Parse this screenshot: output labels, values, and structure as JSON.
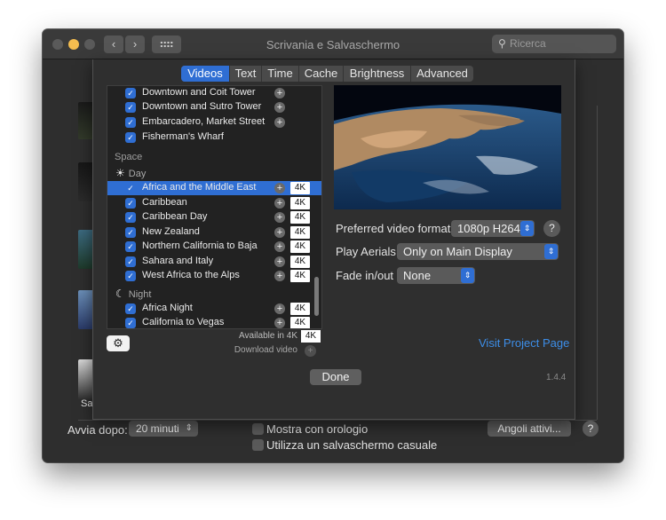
{
  "window": {
    "title": "Scrivania e Salvaschermo",
    "search_placeholder": "Ricerca",
    "nav_back": "‹",
    "nav_forward": "›"
  },
  "tabs": [
    "Videos",
    "Text",
    "Time",
    "Cache",
    "Brightness",
    "Advanced"
  ],
  "active_tab": "Videos",
  "video_list": {
    "city_items": [
      {
        "name": "Downtown and Coit Tower",
        "checked": true
      },
      {
        "name": "Downtown and Sutro Tower",
        "checked": true
      },
      {
        "name": "Embarcadero, Market Street",
        "checked": true
      },
      {
        "name": "Fisherman's Wharf",
        "checked": true
      }
    ],
    "section": "Space",
    "day_label": "Day",
    "day_items": [
      {
        "name": "Africa and the Middle East",
        "badge": "4K",
        "selected": true
      },
      {
        "name": "Caribbean",
        "badge": "4K"
      },
      {
        "name": "Caribbean Day",
        "badge": "4K"
      },
      {
        "name": "New Zealand",
        "badge": "4K"
      },
      {
        "name": "Northern California to Baja",
        "badge": "4K"
      },
      {
        "name": "Sahara and Italy",
        "badge": "4K"
      },
      {
        "name": "West Africa to the Alps",
        "badge": "4K"
      }
    ],
    "night_label": "Night",
    "night_items": [
      {
        "name": "Africa Night",
        "badge": "4K"
      },
      {
        "name": "California to Vegas",
        "badge": "4K"
      }
    ]
  },
  "legend": {
    "available_label": "Available in 4K",
    "available_badge": "4K",
    "download_label": "Download video"
  },
  "settings": {
    "preferred_format_label": "Preferred video format",
    "preferred_format_value": "1080p H264",
    "play_aerials_label": "Play Aerials",
    "play_aerials_value": "Only on Main Display",
    "fade_label": "Fade in/out",
    "fade_value": "None",
    "help": "?"
  },
  "visit_link": "Visit Project Page",
  "done_label": "Done",
  "version": "1.4.4",
  "left_panel": {
    "selected_saver": "SaveHollywood"
  },
  "bottom": {
    "start_after_label": "Avvia dopo:",
    "start_after_value": "20 minuti",
    "show_clock_label": "Mostra con orologio",
    "random_saver_label": "Utilizza un salvaschermo casuale",
    "hot_corners_label": "Angoli attivi...",
    "help": "?"
  },
  "colors": {
    "accent": "#2f6ed3",
    "link": "#3d8ee8",
    "window_bg": "#2e2e2e"
  }
}
